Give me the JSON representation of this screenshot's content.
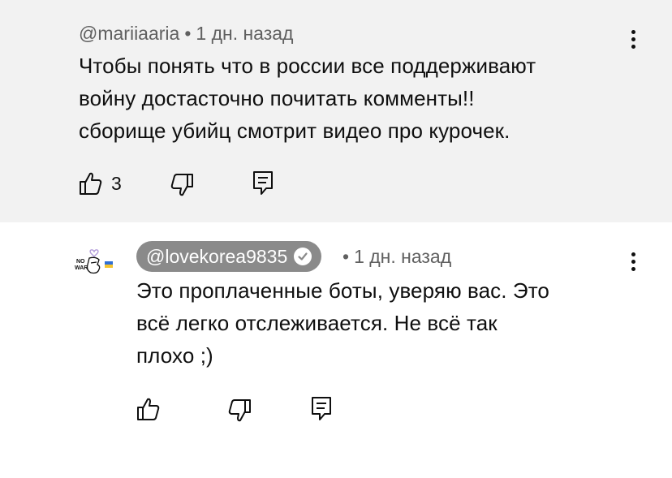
{
  "comment": {
    "author": "@mariiaaria",
    "separator": "•",
    "time": "1 дн. назад",
    "lines": [
      "Чтобы понять что в россии все поддерживают",
      "войну достасточно почитать комменты!!",
      "сборище убийц смотрит видео про курочек."
    ],
    "likes": "3",
    "icons": {
      "like": "thumbs-up-icon",
      "dislike": "thumbs-down-icon",
      "reply": "reply-icon",
      "more": "more-vertical-icon"
    }
  },
  "reply": {
    "author": "@lovekorea9835",
    "verified": true,
    "separator": "•",
    "time": "1 дн. назад",
    "lines": [
      "Это проплаченные боты, уверяю вас. Это",
      "всё легко отслеживается. Не всё так",
      "плохо ;)"
    ],
    "avatar": {
      "text_top": "NO",
      "text_bottom": "WAR",
      "icon": "heart-hand-avatar"
    },
    "icons": {
      "like": "thumbs-up-icon",
      "dislike": "thumbs-down-icon",
      "reply": "reply-icon",
      "more": "more-vertical-icon"
    }
  },
  "colors": {
    "top_background": "#f2f2f2",
    "secondary_text": "#606060",
    "chip_background": "#8a8a8a",
    "ukraine_blue": "#2f6fd6",
    "ukraine_yellow": "#f4c430",
    "heart": "#b39ddb"
  }
}
